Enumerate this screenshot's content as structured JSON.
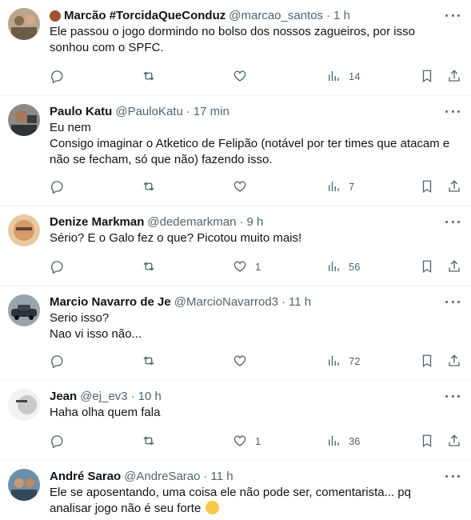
{
  "tweets": [
    {
      "name": "Marcão #TorcidaQueConduz",
      "handle": "@marcao_santos",
      "time": "1 h",
      "lines": [
        "Ele passou o jogo dormindo no bolso dos nossos zagueiros,  por isso",
        "sonhou com o SPFC."
      ],
      "likes": "",
      "views": "14",
      "avatar_color": "#c9a27a"
    },
    {
      "name": "Paulo Katu",
      "handle": "@PauloKatu",
      "time": "17 min",
      "lines": [
        "Eu nem",
        "Consigo imaginar o Atketico de Felipão (notável por ter times que atacam e",
        "não se fecham, só que não) fazendo isso."
      ],
      "likes": "",
      "views": "7",
      "avatar_color": "#6b5a4e"
    },
    {
      "name": "Denize Markman",
      "handle": "@dedemarkman",
      "time": "9 h",
      "lines": [
        "Sério? E o Galo fez o que? Picotou muito mais!"
      ],
      "likes": "1",
      "views": "56",
      "avatar_color": "#d9a066"
    },
    {
      "name": "Marcio Navarro de Je",
      "handle": "@MarcioNavarrod3",
      "time": "11 h",
      "lines": [
        "Serio isso?",
        "Nao vi isso não..."
      ],
      "likes": "",
      "views": "72",
      "avatar_color": "#7b8794"
    },
    {
      "name": "Jean",
      "handle": "@ej_ev3",
      "time": "10 h",
      "lines": [
        "Haha olha quem fala"
      ],
      "likes": "1",
      "views": "36",
      "avatar_color": "#e6e6e6"
    },
    {
      "name": "André Sarao",
      "handle": "@AndreSarao",
      "time": "11 h",
      "lines": [
        "Ele se aposentando, uma coisa ele não pode ser,  comentarista... pq",
        "analisar jogo não é seu forte"
      ],
      "likes": "",
      "views": "",
      "avatar_color": "#4a6d8c"
    }
  ],
  "ui": {
    "dot": "·",
    "more_icon": "more-horizontal-icon"
  }
}
